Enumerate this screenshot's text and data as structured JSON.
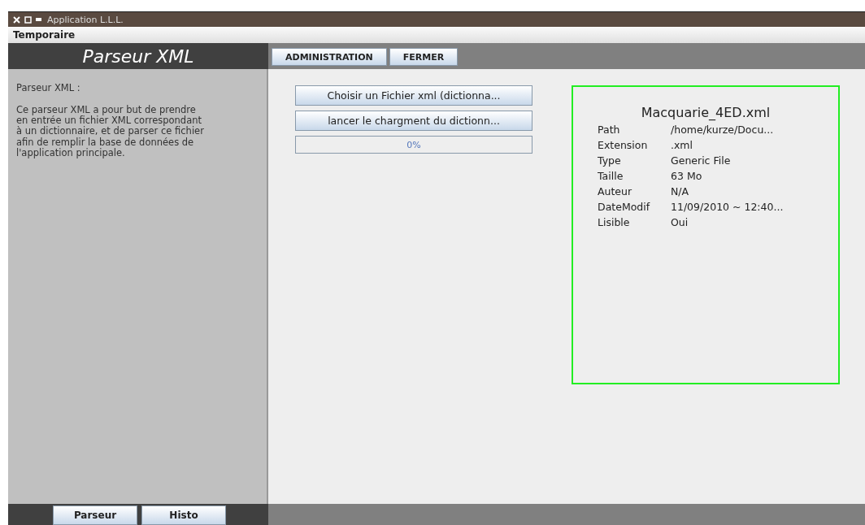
{
  "window": {
    "title": "Application L.L.L."
  },
  "menu": [
    "Temporaire"
  ],
  "sidebar": {
    "title": "Parseur XML",
    "heading": "Parseur XML :",
    "description": "Ce parseur XML a pour but de prendre\nen entrée un fichier XML correspondant\nà un dictionnaire, et de parser ce fichier\nafin de remplir la base de données de\nl'application principale."
  },
  "tabs": [
    {
      "label": "ADMINISTRATION"
    },
    {
      "label": "FERMER"
    }
  ],
  "actions": [
    "Choisir un Fichier xml (dictionna...",
    "lancer le chargment du dictionn..."
  ],
  "progress": {
    "level": 0,
    "label": "0%"
  },
  "file_info": {
    "title": "Macquarie_4ED.xml",
    "rows": [
      {
        "label": "Path",
        "value": "/home/kurze/Docu..."
      },
      {
        "label": "Extension",
        "value": ".xml"
      },
      {
        "label": "Type",
        "value": "Generic File"
      },
      {
        "label": "Taille",
        "value": "63 Mo"
      },
      {
        "label": "Auteur",
        "value": "N/A"
      },
      {
        "label": "DateModif",
        "value": "11/09/2010 ~ 12:40..."
      },
      {
        "label": "Lisible",
        "value": "Oui"
      }
    ]
  },
  "bottom_buttons": [
    "Parseur",
    "Histo"
  ]
}
